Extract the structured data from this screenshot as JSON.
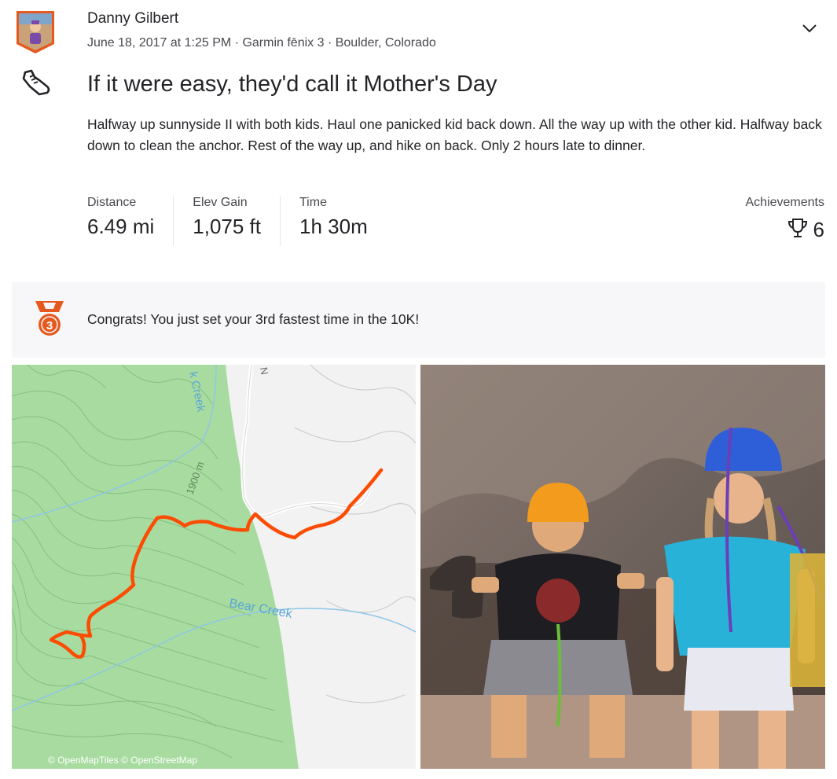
{
  "activity": {
    "owner_name": "Danny Gilbert",
    "meta": "June 18, 2017 at 1:25 PM · Garmin fēnix 3 · Boulder, Colorado",
    "title": "If it were easy, they'd call it Mother's Day",
    "description": "Halfway up sunnyside II with both kids. Haul one panicked kid back down. All the way up with the other kid. Halfway back down to clean the anchor. Rest of the way up, and hike on back. Only 2 hours late to dinner.",
    "sport_icon": "run-shoe-icon",
    "menu_icon": "chevron-down-icon"
  },
  "stats": [
    {
      "label": "Distance",
      "value": "6.49 mi"
    },
    {
      "label": "Elev Gain",
      "value": "1,075 ft"
    },
    {
      "label": "Time",
      "value": "1h 30m"
    }
  ],
  "achievements": {
    "label": "Achievements",
    "count": "6",
    "icon": "trophy-icon"
  },
  "banner": {
    "medal_rank": "3",
    "text": "Congrats! You just set your 3rd fastest time in the 10K!",
    "medal_color": "#e6591e"
  },
  "map": {
    "labels": {
      "creek_top": "k Creek",
      "elevation": "1900 m",
      "bear_creek": "Bear Creek",
      "road": "N"
    },
    "attribution": "© OpenMapTiles © OpenStreetMap",
    "route_color": "#fc4c02",
    "park_color": "#a8dba0"
  },
  "colors": {
    "brand": "#fc4c02",
    "text": "#242428",
    "muted": "#494950"
  }
}
